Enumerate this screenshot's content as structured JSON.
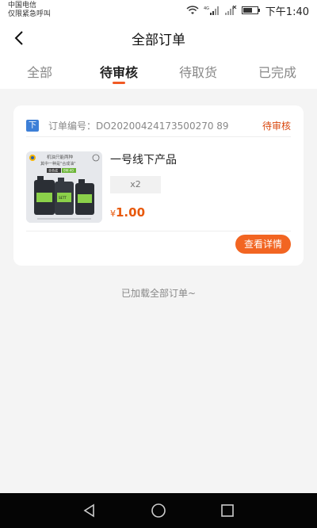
{
  "status_bar": {
    "carrier_line1": "中国电信",
    "carrier_line2": "仅限紧急呼叫",
    "time": "下午1:40",
    "network_badge": "4G"
  },
  "header": {
    "back_icon": "chevron-left-icon",
    "title": "全部订单"
  },
  "tabs": [
    {
      "label": "全部",
      "active": false
    },
    {
      "label": "待审核",
      "active": true
    },
    {
      "label": "待取货",
      "active": false
    },
    {
      "label": "已完成",
      "active": false
    }
  ],
  "order": {
    "store_badge": "下",
    "order_number": "订单编号：DO20200424173500270 89",
    "status": "待审核",
    "product": {
      "name": "一号线下产品",
      "quantity": "x2",
      "currency": "¥",
      "price": "1.00",
      "image": {
        "line1": "机油只能两种",
        "line2": "其中一种是\"合成油\"",
        "tag_left": "全合成",
        "tag_right": "0W-40",
        "bottle_label": "SETT"
      }
    },
    "detail_button": "查看详情"
  },
  "footer_text": "已加载全部订单~",
  "colors": {
    "accent": "#f26522",
    "status": "#d9480f",
    "badge": "#3d7fd7"
  }
}
